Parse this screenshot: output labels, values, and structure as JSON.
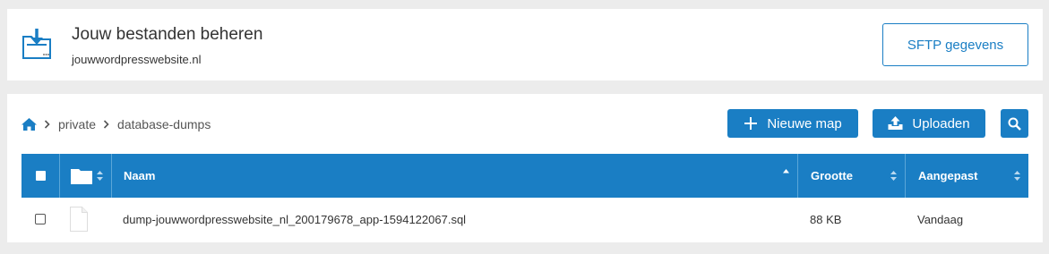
{
  "header": {
    "title": "Jouw bestanden beheren",
    "domain": "jouwwordpresswebsite.nl",
    "sftp_button": "SFTP gegevens"
  },
  "breadcrumb": {
    "items": [
      "private",
      "database-dumps"
    ]
  },
  "toolbar": {
    "new_folder": "Nieuwe map",
    "upload": "Uploaden"
  },
  "table": {
    "columns": {
      "name": "Naam",
      "size": "Grootte",
      "modified": "Aangepast"
    },
    "rows": [
      {
        "name": "dump-jouwwordpresswebsite_nl_200179678_app-1594122067.sql",
        "size": "88 KB",
        "modified": "Vandaag",
        "icon": "file-icon"
      }
    ]
  },
  "colors": {
    "accent": "#1a7ec4",
    "background": "#ececec"
  }
}
